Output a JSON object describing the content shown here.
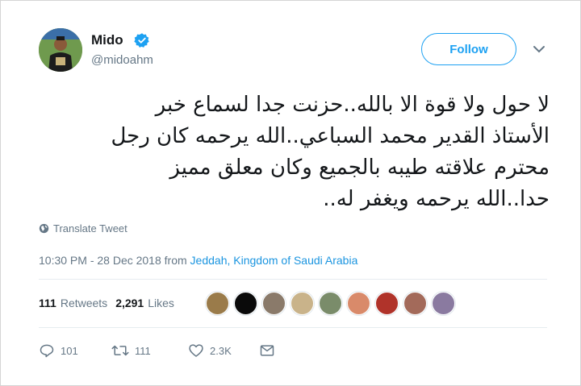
{
  "user": {
    "name": "Mido",
    "handle": "@midoahm",
    "verified": true
  },
  "follow_label": "Follow",
  "tweet": {
    "text": "لا حول ولا قوة الا بالله..حزنت جدا لسماع خبر\nالأستاذ القدير محمد السباعي..الله يرحمه كان رجل\nمحترم علاقته طيبه بالجميع وكان معلق مميز\nحدا..الله يرحمه ويغفر له..",
    "translate_label": "Translate Tweet",
    "time": "10:30 PM - 28 Dec 2018 from",
    "location": "Jeddah, Kingdom of Saudi Arabia"
  },
  "stats": {
    "retweets_count": "111",
    "retweets_label": "Retweets",
    "likes_count": "2,291",
    "likes_label": "Likes"
  },
  "likers": [
    {
      "icon": "liker-avatar",
      "color": "#9a7b4a"
    },
    {
      "icon": "liker-avatar",
      "color": "#0a0a0a"
    },
    {
      "icon": "liker-avatar",
      "color": "#8a7a6a"
    },
    {
      "icon": "liker-avatar",
      "color": "#c9b38a"
    },
    {
      "icon": "liker-avatar",
      "color": "#7a8c6a"
    },
    {
      "icon": "liker-avatar",
      "color": "#d98a6a"
    },
    {
      "icon": "liker-avatar",
      "color": "#b0332a"
    },
    {
      "icon": "liker-avatar",
      "color": "#a36a5a"
    },
    {
      "icon": "liker-avatar",
      "color": "#8a7aa0"
    }
  ],
  "actions": {
    "replies": "101",
    "retweets": "111",
    "likes": "2.3K"
  },
  "colors": {
    "accent": "#1da1f2",
    "link": "#1b95e0",
    "muted": "#657786"
  }
}
